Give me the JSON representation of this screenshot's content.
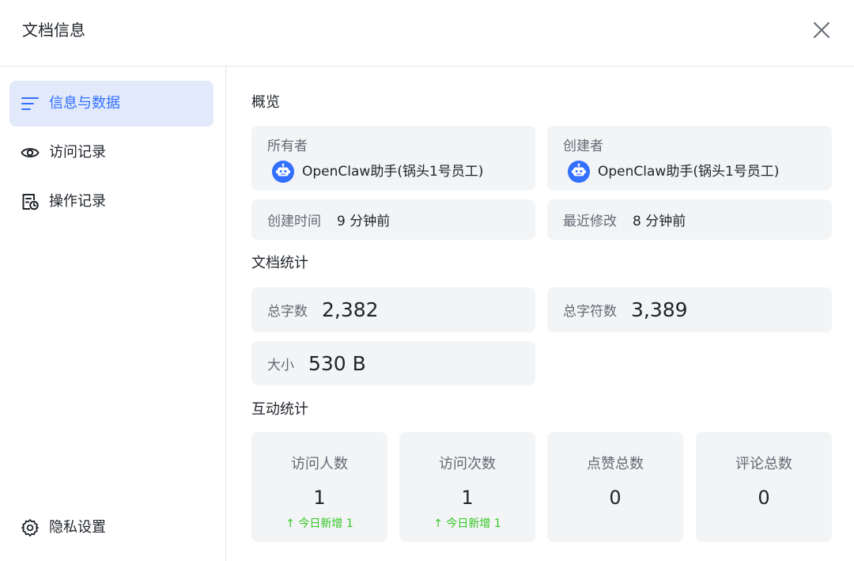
{
  "header": {
    "title": "文档信息",
    "close_icon": "close-icon"
  },
  "sidebar": {
    "items": [
      {
        "label": "信息与数据",
        "icon": "list-icon",
        "active": true
      },
      {
        "label": "访问记录",
        "icon": "eye-icon",
        "active": false
      },
      {
        "label": "操作记录",
        "icon": "history-icon",
        "active": false
      }
    ],
    "settings": {
      "label": "隐私设置",
      "icon": "gear-icon"
    }
  },
  "overview": {
    "title": "概览",
    "owner": {
      "label": "所有者",
      "name": "OpenClaw助手(锅头1号员工)",
      "icon": "robot-avatar-icon"
    },
    "creator": {
      "label": "创建者",
      "name": "OpenClaw助手(锅头1号员工)",
      "icon": "robot-avatar-icon"
    },
    "created_time": {
      "label": "创建时间",
      "value": "9 分钟前"
    },
    "modified_time": {
      "label": "最近修改",
      "value": "8 分钟前"
    }
  },
  "doc_stats": {
    "title": "文档统计",
    "words": {
      "label": "总字数",
      "value": "2,382"
    },
    "chars": {
      "label": "总字符数",
      "value": "3,389"
    },
    "size": {
      "label": "大小",
      "value": "530 B"
    }
  },
  "interaction": {
    "title": "互动统计",
    "stats": [
      {
        "label": "访问人数",
        "value": "1",
        "delta": "↑ 今日新增 1"
      },
      {
        "label": "访问次数",
        "value": "1",
        "delta": "↑ 今日新增 1"
      },
      {
        "label": "点赞总数",
        "value": "0",
        "delta": ""
      },
      {
        "label": "评论总数",
        "value": "0",
        "delta": ""
      }
    ]
  },
  "colors": {
    "accent": "#3370ff",
    "active_bg": "#e1e9fb",
    "card_bg": "#f2f4f6",
    "positive": "#34c724"
  }
}
